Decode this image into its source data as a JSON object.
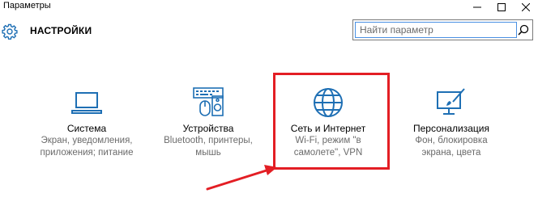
{
  "window": {
    "title": "Параметры"
  },
  "header": {
    "title": "НАСТРОЙКИ",
    "search_placeholder": "Найти параметр"
  },
  "tiles": [
    {
      "name": "Система",
      "desc_line1": "Экран, уведомления,",
      "desc_line2": "приложения; питание",
      "icon": "laptop-icon"
    },
    {
      "name": "Устройства",
      "desc_line1": "Bluetooth, принтеры,",
      "desc_line2": "мышь",
      "icon": "devices-icon"
    },
    {
      "name": "Сеть и Интернет",
      "desc_line1": "Wi-Fi, режим \"в",
      "desc_line2": "самолете\", VPN",
      "icon": "globe-icon"
    },
    {
      "name": "Персонализация",
      "desc_line1": "Фон, блокировка",
      "desc_line2": "экрана, цвета",
      "icon": "personalization-icon"
    }
  ],
  "colors": {
    "accent": "#1e6fb4",
    "highlight": "#e31e24",
    "secondary_text": "#6b6b6b"
  }
}
